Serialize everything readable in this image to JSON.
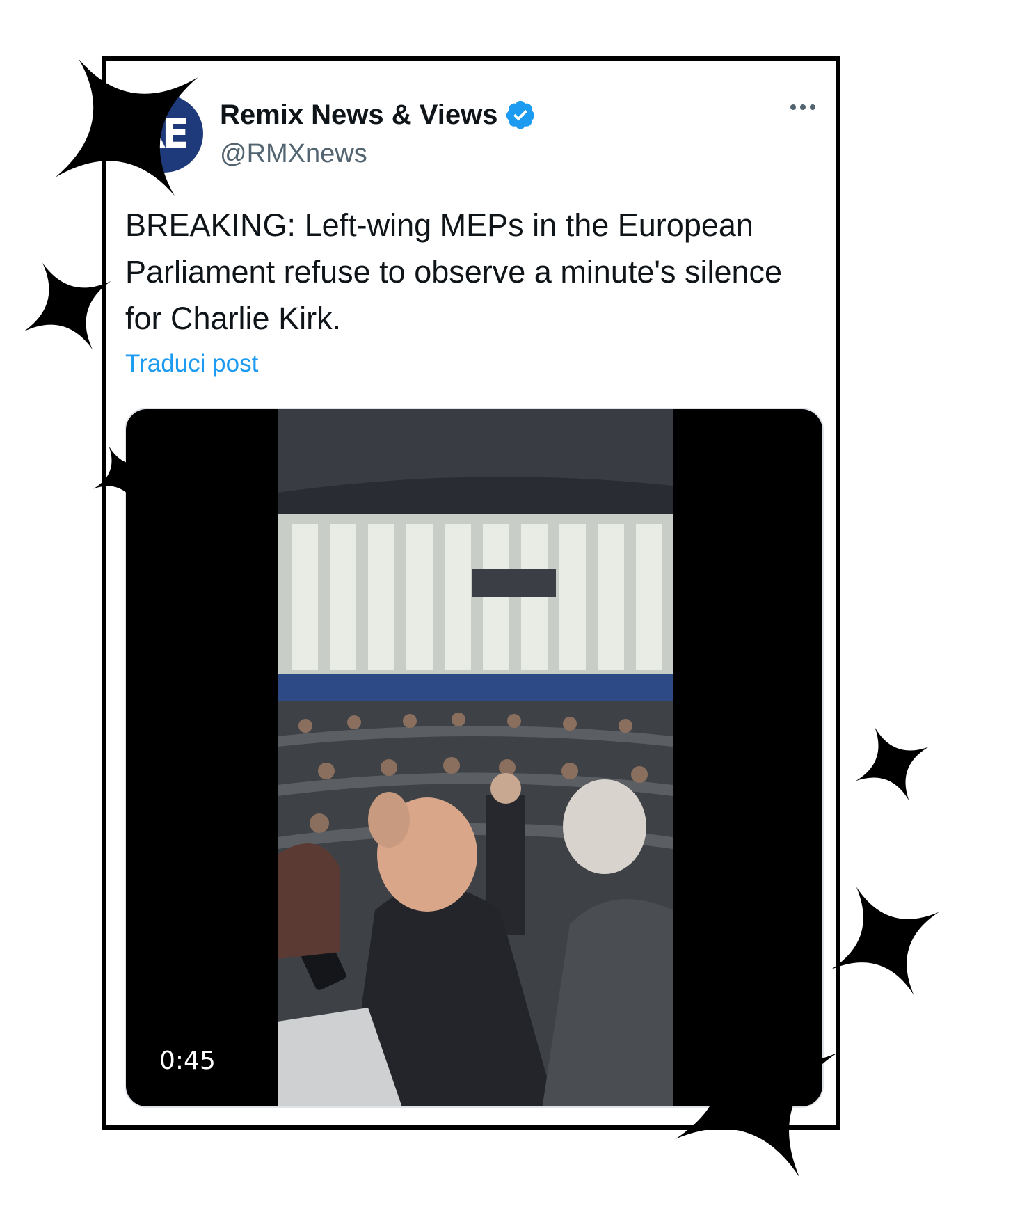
{
  "post": {
    "display_name": "Remix News & Views",
    "handle": "@RMXnews",
    "avatar_text": "RE",
    "verified": true,
    "text": "BREAKING: Left-wing MEPs in the European Parliament refuse to observe a minute's silence for Charlie Kirk.",
    "translate_label": "Traduci post",
    "media": {
      "type": "video",
      "duration": "0:45"
    }
  },
  "colors": {
    "accent": "#1d9bf0",
    "avatar_bg": "#1f3a7a",
    "text_primary": "#0f1419",
    "text_secondary": "#536471"
  },
  "icons": {
    "verified": "verified-badge-icon",
    "more": "more-options-icon",
    "decoration": "sparkle-icon"
  }
}
